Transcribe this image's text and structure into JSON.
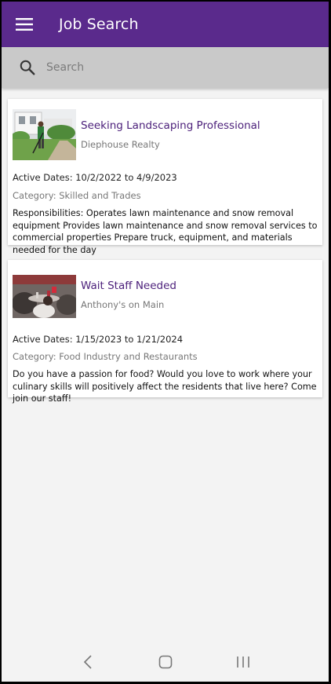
{
  "app": {
    "title": "Job Search"
  },
  "search": {
    "placeholder": "Search",
    "value": ""
  },
  "jobs": [
    {
      "title": "Seeking Landscaping Professional",
      "company": "Diephouse Realty",
      "dates": "Active Dates: 10/2/2022 to 4/9/2023",
      "category": "Category: Skilled and Trades",
      "description": "Responsibilities:   Operates lawn maintenance and snow removal equipment  Provides lawn maintenance and snow removal services to commercial properties  Prepare truck, equipment, and materials needed for the day"
    },
    {
      "title": "Wait Staff Needed",
      "company": "Anthony's on Main",
      "dates": "Active Dates: 1/15/2023 to 1/21/2024",
      "category": "Category: Food Industry and Restaurants",
      "description": "Do you have a passion for food? Would you love to work where your culinary skills will positively affect the residents that live here? Come join our staff!"
    }
  ],
  "colors": {
    "appbar": "#5a2a8c",
    "title_accent": "#4b1f7a"
  },
  "icons": {
    "menu": "hamburger-menu-icon",
    "search": "search-icon",
    "back": "back-icon",
    "home": "home-icon",
    "recents": "recents-icon"
  }
}
